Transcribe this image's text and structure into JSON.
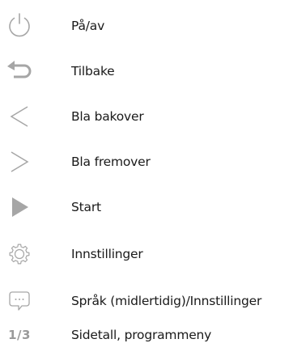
{
  "legend": {
    "items": [
      {
        "icon": "power-icon",
        "label": "På/av"
      },
      {
        "icon": "back-arrow-icon",
        "label": "Tilbake"
      },
      {
        "icon": "chevron-left-icon",
        "label": "Bla bakover"
      },
      {
        "icon": "chevron-right-icon",
        "label": "Bla fremover"
      },
      {
        "icon": "play-icon",
        "label": "Start"
      },
      {
        "icon": "gear-icon",
        "label": "Innstillinger"
      },
      {
        "icon": "speech-bubble-icon",
        "label": "Språk (midlertidig)/Innstillinger"
      },
      {
        "icon": "page-indicator",
        "icon_text": "1/3",
        "label": "Sidetall, programmeny"
      }
    ]
  },
  "colors": {
    "icon": "#a6a6a6",
    "text": "#1a1a1a"
  }
}
